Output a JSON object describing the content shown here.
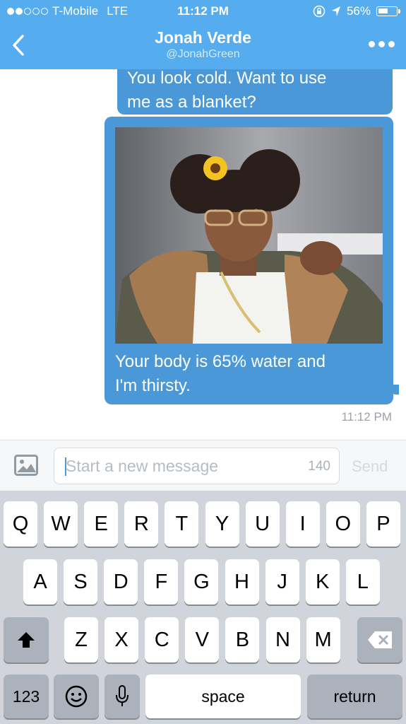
{
  "status_bar": {
    "carrier": "T-Mobile",
    "network": "LTE",
    "time": "11:12 PM",
    "battery": "56%",
    "battery_level": 0.56,
    "signal_bars_filled": 2,
    "signal_bars_total": 5
  },
  "header": {
    "title": "Jonah Verde",
    "handle": "@JonahGreen"
  },
  "messages": [
    {
      "text_line1": "You look cold. Want to use",
      "text_line2": "me as a blanket?"
    },
    {
      "text_line1": "Your body is 65% water and",
      "text_line2": "I'm thirsty."
    }
  ],
  "timestamp": "11:12 PM",
  "compose": {
    "placeholder": "Start a new message",
    "counter": "140",
    "send_label": "Send"
  },
  "keyboard": {
    "row1": [
      "Q",
      "W",
      "E",
      "R",
      "T",
      "Y",
      "U",
      "I",
      "O",
      "P"
    ],
    "row2": [
      "A",
      "S",
      "D",
      "F",
      "G",
      "H",
      "J",
      "K",
      "L"
    ],
    "row3": [
      "Z",
      "X",
      "C",
      "V",
      "B",
      "N",
      "M"
    ],
    "numbers_label": "123",
    "space_label": "space",
    "return_label": "return"
  },
  "colors": {
    "header": "#55acee",
    "bubble": "#4a98d8",
    "keyboard": "#d1d5db"
  },
  "icons": {
    "back": "chevron-left-icon",
    "more": "more-dots-icon",
    "image": "image-icon",
    "shift": "shift-arrow-icon",
    "delete": "backspace-icon",
    "emoji": "emoji-icon",
    "mic": "microphone-icon",
    "lock": "rotation-lock-icon",
    "location": "location-arrow-icon"
  }
}
